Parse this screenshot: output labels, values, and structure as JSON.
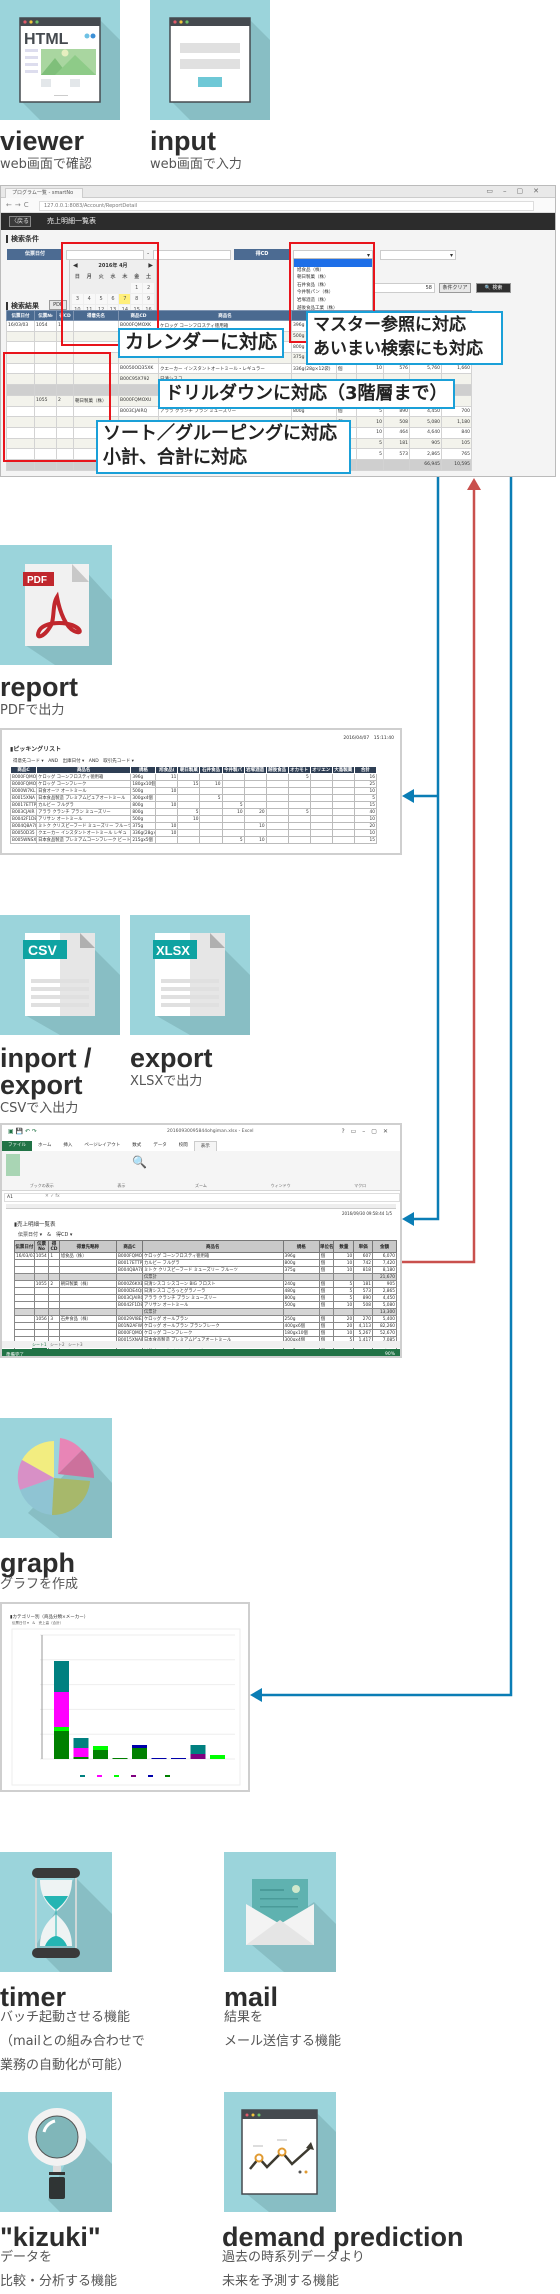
{
  "features": {
    "viewer": {
      "title": "viewer",
      "sub": [
        "web画面で確認"
      ],
      "icon": "html-window-icon",
      "icon_text": "HTML"
    },
    "input": {
      "title": "input",
      "sub": [
        "web画面で入力"
      ],
      "icon": "input-form-icon"
    },
    "report": {
      "title": "report",
      "sub": [
        "PDFで出力"
      ],
      "icon": "pdf-file-icon",
      "icon_text": "PDF"
    },
    "csv": {
      "title_lines": [
        "inport /",
        "export"
      ],
      "sub": [
        "CSVで入出力"
      ],
      "icon": "csv-file-icon",
      "icon_text": "CSV"
    },
    "xlsx": {
      "title": "export",
      "sub": [
        "XLSXで出力"
      ],
      "icon": "xlsx-file-icon",
      "icon_text": "XLSX"
    },
    "graph": {
      "title": "graph",
      "sub": [
        "グラフを作成"
      ],
      "icon": "pie-chart-icon"
    },
    "timer": {
      "title": "timer",
      "sub": [
        "バッチ起動させる機能",
        "（mailとの組み合わせで",
        "業務の自動化が可能）"
      ],
      "icon": "hourglass-icon"
    },
    "mail": {
      "title": "mail",
      "sub": [
        "結果を",
        "メール送信する機能"
      ],
      "icon": "envelope-icon"
    },
    "kizuki": {
      "title": "\"kizuki\"",
      "sub": [
        "データを",
        "比較・分析する機能"
      ],
      "icon": "magnifier-icon"
    },
    "demand": {
      "title": "demand prediction",
      "sub": [
        "過去の時系列データより",
        "未来を予測する機能"
      ],
      "icon": "trend-chart-window-icon"
    }
  },
  "colors": {
    "icon_bg": "#9bd4db",
    "icon_shadow": "#88bec4",
    "arrow_blue": "#0a7db5",
    "arrow_red": "#c9504d",
    "highlight_red": "#e8141b",
    "callout_blue": "#1aa0d8"
  },
  "browser": {
    "tab_title": "プログラム一覧 - smartNo",
    "url": "127.0.0.1:8083/Account/ReportDetail",
    "back_label": "〈戻る",
    "page_title": "売上明細一覧表",
    "search_section": "検索条件",
    "date_label": "伝票日付",
    "range_sep": "-",
    "customer_label": "得CD",
    "count": "58",
    "clear_label": "条件クリア",
    "search_label": "🔍 検索",
    "calendar": {
      "title": "2016年 4月",
      "weekdays": [
        "日",
        "月",
        "火",
        "水",
        "木",
        "金",
        "土"
      ],
      "leading_blanks": 5,
      "days": [
        1,
        2,
        3,
        4,
        5,
        6,
        7,
        8,
        9,
        10,
        11,
        12,
        13,
        14,
        15,
        16,
        17,
        18,
        19,
        20,
        21,
        22,
        23,
        24,
        25,
        26,
        27
      ],
      "today": 7
    },
    "dropdown_items": [
      "",
      "旭食品（株）",
      "朝日製菓（株）",
      "石井食品（株）",
      "今井製パン（株）",
      "岩塚酒造（株）",
      "越後食品工業（株）",
      "オカ",
      "オリ",
      "大島",
      "岡山"
    ],
    "results_section": "検索結果",
    "pdf_label": "PDF",
    "columns": [
      "伝票日付",
      "伝票№",
      "得CD",
      "得意先名",
      "商品CD",
      "商品名",
      "規格",
      "単位",
      "数量",
      "単価",
      "金額",
      "粗利"
    ],
    "rows": [
      [
        "16/03/03",
        "1054",
        "1",
        "",
        "B000FQMOXK",
        "ケロッグ コーンフロスティ徳用箱",
        "396g",
        "",
        "",
        "",
        "",
        ""
      ],
      [
        "",
        "",
        "",
        "",
        "",
        "",
        "500g",
        "",
        "",
        "",
        "",
        ""
      ],
      [
        "",
        "",
        "",
        "",
        "",
        "",
        "800g",
        "",
        "",
        "",
        "",
        ""
      ],
      [
        "",
        "",
        "",
        "",
        "",
        "",
        "375g",
        "",
        "",
        "",
        "",
        ""
      ],
      [
        "",
        "",
        "",
        "",
        "B0050OD35XK",
        "クエーカー インスタントオートミール・レギュラー",
        "336g(28g×12袋)",
        "個",
        "10",
        "576",
        "5,760",
        "1,660"
      ],
      [
        "",
        "",
        "",
        "",
        "B00C95X792",
        "日清シスコ",
        "",
        "",
        "",
        "",
        "",
        ""
      ],
      [
        "sub",
        "",
        "",
        "",
        "",
        "伝",
        "",
        "",
        "",
        "",
        "",
        ""
      ],
      [
        "",
        "1055",
        "2",
        "朝日製菓（株）",
        "B000FQMOXU",
        "ケロ",
        "",
        "",
        "",
        "",
        "",
        ""
      ],
      [
        "",
        "",
        "",
        "",
        "B003CJAIRQ",
        "アララ クランチ ブラン ミューズリー",
        "800g",
        "個",
        "5",
        "890",
        "4,450",
        "700"
      ],
      [
        "",
        "",
        "",
        "",
        "",
        "",
        "",
        "個",
        "10",
        "508",
        "5,080",
        "1,180"
      ],
      [
        "",
        "",
        "",
        "",
        "",
        "",
        "",
        "",
        "10",
        "464",
        "4,640",
        "840"
      ],
      [
        "",
        "",
        "",
        "",
        "",
        "",
        "",
        "",
        "5",
        "181",
        "905",
        "105"
      ],
      [
        "",
        "",
        "",
        "",
        "",
        "",
        "",
        "",
        "5",
        "573",
        "2,865",
        "765"
      ],
      [
        "sub",
        "",
        "",
        "",
        "",
        "",
        "",
        "",
        "",
        "",
        "66,945",
        "10,595"
      ]
    ],
    "callouts": {
      "calendar": "カレンダーに対応",
      "master": [
        "マスター参照に対応",
        "あいまい検索にも対応"
      ],
      "drilldown": "ドリルダウンに対応（3階層まで）",
      "sort": [
        "ソート／グルーピングに対応",
        "小計、合計に対応"
      ]
    }
  },
  "report_preview": {
    "title": "ピッキングリスト",
    "timestamp": "2016/04/07　15:11:40",
    "filter": "得意先コード ▾　AND　出庫日付 ▾　AND　取引先コード ▾",
    "columns": [
      "商品C",
      "商品名",
      "規格",
      "旭食品(",
      "朝日製菓",
      "石井食品",
      "今井製パ",
      "岩塚酒造",
      "越後食品",
      "オカモト",
      "オリエン",
      "大島製菓",
      "合計"
    ],
    "rows": [
      [
        "B000FQMO",
        "ケロッグ コーンフロスティ徳用箱",
        "396g",
        "11",
        "",
        "",
        "",
        "",
        "",
        "5",
        "",
        "",
        "16"
      ],
      [
        "B000FQMO",
        "ケロッグ コーンフレーク",
        "180gx10個",
        "",
        "15",
        "10",
        "",
        "",
        "",
        "",
        "",
        "",
        "25"
      ],
      [
        "B000W7KL",
        "日食オーツ オートミール",
        "500g",
        "10",
        "",
        "",
        "",
        "",
        "",
        "",
        "",
        "",
        "10"
      ],
      [
        "B0015XNA",
        "日本食品製造 プレミアムピュアオートミール",
        "300gx4個",
        "",
        "",
        "5",
        "",
        "",
        "",
        "",
        "",
        "",
        "5"
      ],
      [
        "B0017ETTP",
        "カルビー フルグラ",
        "800g",
        "10",
        "",
        "",
        "5",
        "",
        "",
        "",
        "",
        "",
        "15"
      ],
      [
        "B003CJAIR",
        "アララ クランチ ブラン ミューズリー",
        "800g",
        "",
        "5",
        "",
        "10",
        "20",
        "",
        "5",
        "",
        "",
        "40"
      ],
      [
        "B0042F1D8",
        "アリサン オートミール",
        "500g",
        "",
        "10",
        "",
        "",
        "",
        "",
        "",
        "",
        "",
        "10"
      ],
      [
        "B004Q8A78",
        "ミトク クリスピーフード ミューズリー フルーツ",
        "375g",
        "10",
        "",
        "",
        "",
        "10",
        "",
        "",
        "",
        "",
        "20"
      ],
      [
        "B0050D35",
        "クエーカー インスタントオートミール レギュ",
        "336g(28g×1",
        "10",
        "",
        "",
        "",
        "",
        "",
        "",
        "",
        "",
        "10"
      ],
      [
        "B005WNSX",
        "日本食品製造 プレミアムコーンフレーク ビート",
        "215gx5個",
        "",
        "",
        "",
        "5",
        "10",
        "",
        "",
        "",
        "",
        "15"
      ]
    ]
  },
  "excel_preview": {
    "window_title": "20160930095844ohgiman.xlsx - Excel",
    "ribbon_tabs": [
      "ファイル",
      "ホーム",
      "挿入",
      "ページレイアウト",
      "数式",
      "データ",
      "校閲",
      "表示"
    ],
    "active_tab": "表示",
    "ribbon_groups": [
      "ブックの表示",
      "表示",
      "ズーム",
      "ウィンドウ",
      "マクロ"
    ],
    "cell_ref": "A1",
    "sheet_title": "売上明細一覧表",
    "sheet_filter": "伝票日付 ▾　&　得CD ▾",
    "sheet_timestamp": "2016/09/30 09:58:44 1/5",
    "columns": [
      "伝票日付",
      "伝票No",
      "得CD",
      "得意先略称",
      "商品C",
      "商品名",
      "規格",
      "単位名",
      "数量",
      "単価",
      "金額"
    ],
    "rows": [
      [
        "16/03/03",
        "1054",
        "1",
        "旭食品（株）",
        "B000FQMOXG",
        "ケロッグ コーンフロスティ徳用箱",
        "396g",
        "個",
        "10",
        "607",
        "6,070"
      ],
      [
        "",
        "",
        "",
        "",
        "B0017ETTPS",
        "カルビー フルグラ",
        "800g",
        "個",
        "10",
        "742",
        "7,420"
      ],
      [
        "",
        "",
        "",
        "",
        "B004Q8A78Z",
        "ミトク クリスピーフード ミューズリー フルーツ",
        "375g",
        "個",
        "10",
        "818",
        "8,180"
      ],
      [
        "sub",
        "",
        "",
        "",
        "",
        "伝票計",
        "",
        "",
        "",
        "",
        "21,670"
      ],
      [
        "",
        "1055",
        "2",
        "朝日製菓（株）",
        "B000Z6KXB",
        "日清シスコ シスコーン BIG フロスト",
        "240g",
        "個",
        "5",
        "181",
        "905"
      ],
      [
        "",
        "",
        "",
        "",
        "B000DE4Q8",
        "日清シスコ ごろっとグラノーラ",
        "480g",
        "個",
        "5",
        "573",
        "2,865"
      ],
      [
        "",
        "",
        "",
        "",
        "B003CJAIRQ",
        "アララ クランチ ブラン ミューズリー",
        "800g",
        "個",
        "5",
        "890",
        "4,450"
      ],
      [
        "",
        "",
        "",
        "",
        "B0042F1D82",
        "アリサン オートミール",
        "500g",
        "個",
        "10",
        "508",
        "5,080"
      ],
      [
        "sub",
        "",
        "",
        "",
        "",
        "伝票計",
        "",
        "",
        "",
        "",
        "13,300"
      ],
      [
        "",
        "1056",
        "3",
        "石井食品（株）",
        "B0029VI8EZ",
        "ケロッグ オールブラン",
        "250g",
        "個",
        "20",
        "270",
        "5,400"
      ],
      [
        "",
        "",
        "",
        "",
        "B01N2AFW1S",
        "ケロッグ オールブラン ブランフレーク",
        "400gx6個",
        "個",
        "20",
        "4,113",
        "82,260"
      ],
      [
        "",
        "",
        "",
        "",
        "B000FQMOXU",
        "ケロッグ コーンフレーク",
        "180gx10個",
        "個",
        "10",
        "5,267",
        "52,670"
      ],
      [
        "",
        "",
        "",
        "",
        "B0015XNAFS",
        "日本食品製造 プレミアムピュアオートミール",
        "300gx4個",
        "個",
        "5",
        "1,417",
        "7,085"
      ],
      [
        "",
        "",
        "",
        "",
        "B005WNSX0Y",
        "日食 プレミアムコーンフレーク",
        "215g",
        "個",
        "5",
        "372",
        "1,860"
      ],
      [
        "",
        "",
        "",
        "",
        "B00K0MFTTP",
        "日清シスコ シスコーン BIG フロスト",
        "240gx6個",
        "個",
        "5",
        "1,183",
        "5,915"
      ]
    ],
    "sheet_tabs": [
      "シート1",
      "シート2",
      "シート3"
    ],
    "status": "準備完了",
    "zoom": "90%"
  },
  "graph_preview": {
    "title": "カテゴリー別（商品分類×メーカー）",
    "filter": "伝票日付 ▾　&　売上高（合計）",
    "series_colors": [
      "#008080",
      "#ff00ff",
      "#00ff00",
      "#800080",
      "#0000aa",
      "#008000"
    ]
  }
}
